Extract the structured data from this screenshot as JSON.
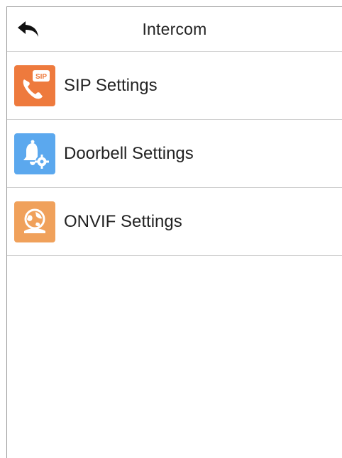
{
  "header": {
    "title": "Intercom",
    "back_icon": "back-arrow-icon"
  },
  "menu": {
    "items": [
      {
        "label": "SIP Settings",
        "icon": "sip-phone-icon",
        "icon_color": "#EE7A3D"
      },
      {
        "label": "Doorbell Settings",
        "icon": "doorbell-gear-icon",
        "icon_color": "#5BA8EE"
      },
      {
        "label": "ONVIF Settings",
        "icon": "onvif-globe-icon",
        "icon_color": "#F0A15B"
      }
    ]
  }
}
